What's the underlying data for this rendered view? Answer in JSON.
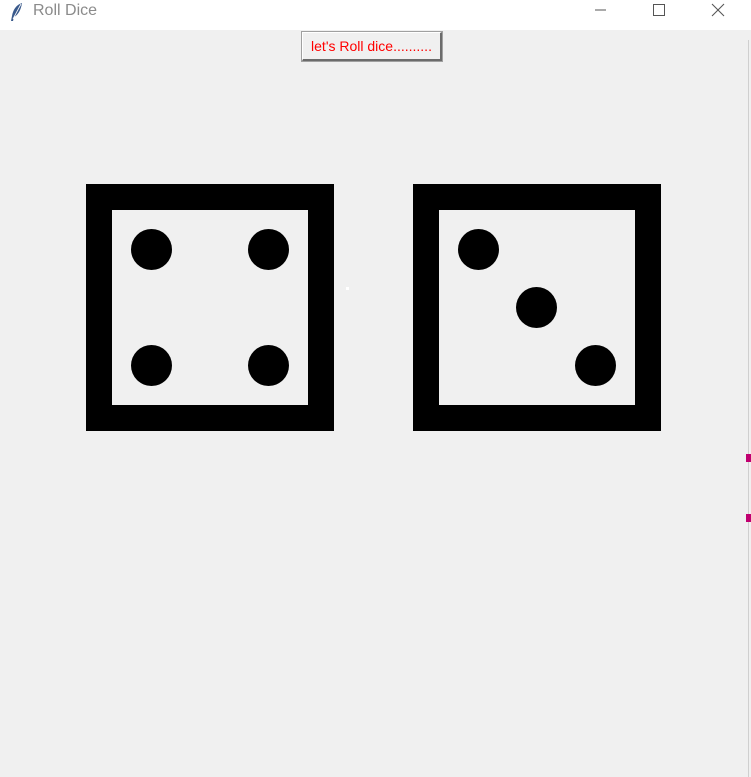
{
  "window": {
    "title": "Roll Dice",
    "icon": "feather-icon",
    "controls": {
      "minimize": "minimize-icon",
      "maximize": "maximize-icon",
      "close": "close-icon"
    }
  },
  "toolbar": {
    "roll_label": "let's Roll dice..........",
    "roll_color": "#ff0000"
  },
  "dice": [
    {
      "value": 4
    },
    {
      "value": 3
    }
  ]
}
